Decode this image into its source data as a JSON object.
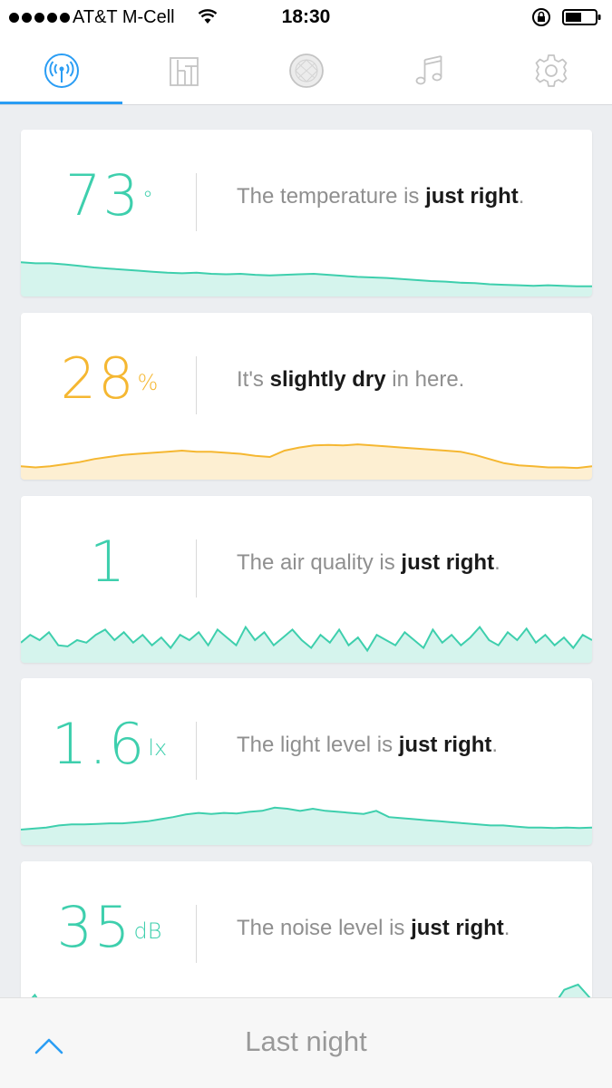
{
  "status_bar": {
    "carrier": "AT&T M-Cell",
    "time": "18:30",
    "signal_icon": "signal-dots-icon",
    "wifi_icon": "wifi-icon",
    "lock_icon": "rotation-lock-icon",
    "battery_icon": "battery-icon"
  },
  "tabs": [
    {
      "icon": "sensor-broadcast-icon",
      "active": true
    },
    {
      "icon": "bar-chart-icon",
      "active": false
    },
    {
      "icon": "orb-icon",
      "active": false
    },
    {
      "icon": "music-note-icon",
      "active": false
    },
    {
      "icon": "gear-icon",
      "active": false
    }
  ],
  "colors": {
    "accent_blue": "#2a9df4",
    "good_green": "#3ecfad",
    "warn_orange": "#f5b731"
  },
  "cards": [
    {
      "name": "temperature",
      "value": "73",
      "unit": "°",
      "color": "#3ecfad",
      "text_pre": "The temperature is ",
      "text_bold": "just right",
      "text_post": ".",
      "chart_data": {
        "type": "area",
        "values": [
          0.62,
          0.6,
          0.6,
          0.58,
          0.55,
          0.52,
          0.5,
          0.48,
          0.46,
          0.44,
          0.42,
          0.41,
          0.42,
          0.4,
          0.39,
          0.4,
          0.38,
          0.37,
          0.38,
          0.39,
          0.4,
          0.38,
          0.36,
          0.34,
          0.33,
          0.32,
          0.3,
          0.28,
          0.26,
          0.25,
          0.23,
          0.22,
          0.2,
          0.19,
          0.18,
          0.17,
          0.18,
          0.17,
          0.16,
          0.16
        ]
      }
    },
    {
      "name": "humidity",
      "value": "28",
      "unit": "%",
      "color": "#f5b731",
      "text_pre": "It's ",
      "text_bold": "slightly dry",
      "text_post": " in here.",
      "chart_data": {
        "type": "area",
        "values": [
          0.22,
          0.2,
          0.22,
          0.26,
          0.3,
          0.36,
          0.4,
          0.44,
          0.46,
          0.48,
          0.5,
          0.52,
          0.5,
          0.5,
          0.48,
          0.46,
          0.42,
          0.4,
          0.52,
          0.58,
          0.62,
          0.63,
          0.62,
          0.64,
          0.62,
          0.6,
          0.58,
          0.56,
          0.54,
          0.52,
          0.5,
          0.44,
          0.36,
          0.28,
          0.24,
          0.22,
          0.2,
          0.2,
          0.19,
          0.22
        ]
      }
    },
    {
      "name": "air-quality",
      "value": "1",
      "unit": "",
      "color": "#3ecfad",
      "text_pre": "The air quality is ",
      "text_bold": "just right",
      "text_post": ".",
      "chart_data": {
        "type": "area",
        "values": [
          0.35,
          0.5,
          0.4,
          0.55,
          0.3,
          0.28,
          0.4,
          0.35,
          0.5,
          0.6,
          0.4,
          0.55,
          0.35,
          0.5,
          0.3,
          0.45,
          0.25,
          0.5,
          0.4,
          0.55,
          0.3,
          0.6,
          0.45,
          0.3,
          0.65,
          0.4,
          0.55,
          0.3,
          0.45,
          0.6,
          0.4,
          0.25,
          0.5,
          0.35,
          0.6,
          0.3,
          0.45,
          0.2,
          0.5,
          0.4,
          0.3,
          0.55,
          0.4,
          0.25,
          0.6,
          0.35,
          0.5,
          0.3,
          0.45,
          0.65,
          0.4,
          0.3,
          0.55,
          0.4,
          0.62,
          0.35,
          0.5,
          0.3,
          0.45,
          0.25,
          0.5,
          0.4
        ]
      }
    },
    {
      "name": "light",
      "value": "1.6",
      "unit": "lx",
      "color": "#3ecfad",
      "text_pre": "The light level is ",
      "text_bold": "just right",
      "text_post": ".",
      "chart_data": {
        "type": "area",
        "values": [
          0.26,
          0.28,
          0.3,
          0.34,
          0.36,
          0.36,
          0.37,
          0.38,
          0.38,
          0.4,
          0.42,
          0.46,
          0.5,
          0.55,
          0.58,
          0.56,
          0.58,
          0.57,
          0.6,
          0.62,
          0.68,
          0.66,
          0.62,
          0.66,
          0.62,
          0.6,
          0.58,
          0.56,
          0.62,
          0.5,
          0.48,
          0.46,
          0.44,
          0.42,
          0.4,
          0.38,
          0.36,
          0.34,
          0.34,
          0.32,
          0.3,
          0.3,
          0.29,
          0.3,
          0.29,
          0.3
        ]
      }
    },
    {
      "name": "noise",
      "value": "35",
      "unit": "dB",
      "color": "#3ecfad",
      "text_pre": "The noise level is ",
      "text_bold": "just right",
      "text_post": ".",
      "chart_data": {
        "type": "area",
        "values": [
          0.3,
          0.6,
          0.2,
          0.5,
          0.2,
          0.3,
          0.2,
          0.4,
          0.2,
          0.25,
          0.5,
          0.2,
          0.4,
          0.2,
          0.3,
          0.2,
          0.45,
          0.2,
          0.3,
          0.25,
          0.2,
          0.4,
          0.2,
          0.3,
          0.2,
          0.5,
          0.2,
          0.3,
          0.2,
          0.35,
          0.2,
          0.25,
          0.4,
          0.2,
          0.3,
          0.2,
          0.45,
          0.2,
          0.3,
          0.7,
          0.8,
          0.5
        ]
      }
    }
  ],
  "bottom_bar": {
    "label": "Last night",
    "chevron_icon": "chevron-up-icon"
  }
}
